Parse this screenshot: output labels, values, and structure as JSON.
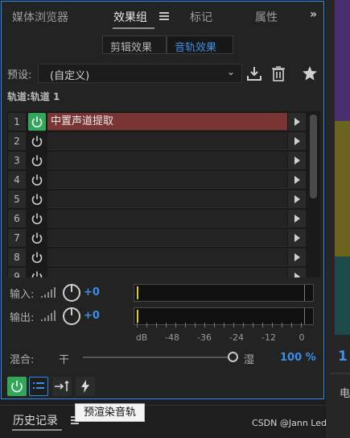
{
  "tabs": [
    {
      "label": "媒体浏览器"
    },
    {
      "label": "效果组"
    },
    {
      "label": "标记"
    },
    {
      "label": "属性"
    }
  ],
  "more_symbol": "»",
  "segments": {
    "clip_effects": "剪辑效果",
    "track_effects": "音轨效果"
  },
  "preset": {
    "label": "预设:",
    "value": "(自定义)",
    "chevron": "⌄"
  },
  "track": {
    "label": "轨道:轨道 1"
  },
  "slots": [
    {
      "num": "1",
      "name": "中置声道提取",
      "on": true
    },
    {
      "num": "2",
      "name": "",
      "on": false
    },
    {
      "num": "3",
      "name": "",
      "on": false
    },
    {
      "num": "4",
      "name": "",
      "on": false
    },
    {
      "num": "5",
      "name": "",
      "on": false
    },
    {
      "num": "6",
      "name": "",
      "on": false
    },
    {
      "num": "7",
      "name": "",
      "on": false
    },
    {
      "num": "8",
      "name": "",
      "on": false
    },
    {
      "num": "9",
      "name": "",
      "on": false
    }
  ],
  "io": {
    "input": {
      "label": "输入:",
      "value": "+0"
    },
    "output": {
      "label": "输出:",
      "value": "+0"
    }
  },
  "meter_scale": [
    "dB",
    "-48",
    "-36",
    "-24",
    "-12",
    "0"
  ],
  "mix": {
    "label": "混合:",
    "dry": "干",
    "wet": "湿",
    "value": "100 %",
    "level": 100
  },
  "tooltip": "预渲染音轨",
  "history": {
    "label": "历史记录"
  },
  "right_panel": {
    "number": "1",
    "text": "电"
  },
  "watermark": "CSDN @Jann Led",
  "colors": {
    "accent": "#2d8ceb",
    "power_on": "#2fa85a",
    "effect_fill": "#7a3434",
    "value_blue": "#3a8fe8"
  }
}
